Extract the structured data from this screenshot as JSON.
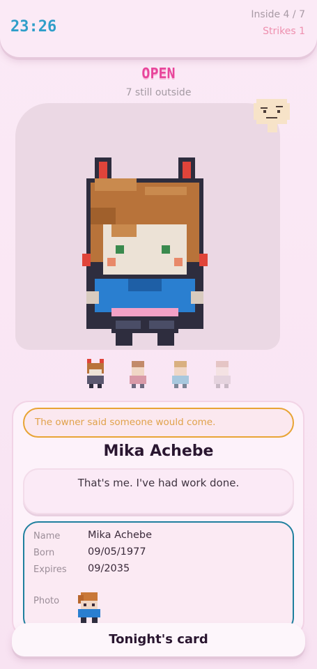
{
  "hud": {
    "clock": "23:26",
    "inside": "Inside 4 / 7",
    "strikes": "Strikes 1"
  },
  "door": {
    "status": "OPEN",
    "outside": "7 still outside"
  },
  "owner_icon": "bald-owner-face-icon",
  "queue_count": 4,
  "notice": "The owner said someone would come.",
  "visitor": {
    "name": "Mika Achebe",
    "speech": "That's me. I've had work done."
  },
  "id_card": {
    "name_label": "Name",
    "name_value": "Mika Achebe",
    "born_label": "Born",
    "born_value": "09/05/1977",
    "expires_label": "Expires",
    "expires_value": "09/2035",
    "photo_label": "Photo"
  },
  "bottom_button": "Tonight's card",
  "colors": {
    "accent_blue": "#2f9ec9",
    "open_pink": "#e8459b",
    "strike_pink": "#ee8fae",
    "notice_orange": "#e8a434",
    "id_border": "#1e7f9e"
  }
}
